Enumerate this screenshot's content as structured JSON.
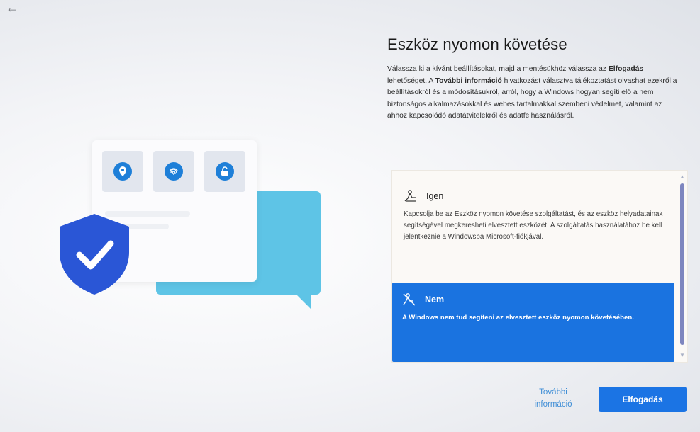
{
  "nav": {
    "back_glyph": "←"
  },
  "page": {
    "title": "Eszköz nyomon követése",
    "description_parts": [
      "Válassza ki a kívánt beállításokat, majd a mentésükhöz válassza az ",
      "Elfogadás",
      " lehetőséget. A ",
      "További információ",
      " hivatkozást választva tájékoztatást olvashat ezekről a beállításokról és a módosításukról, arról, hogy a Windows hogyan segíti elő a nem biztonságos alkalmazásokkal és webes tartalmakkal szembeni védelmet, valamint az ahhoz kapcsolódó adatátvitelekről és adatfelhasználásról."
    ]
  },
  "options": [
    {
      "label": "Igen",
      "icon": "location-person-icon",
      "text": "Kapcsolja be az Eszköz nyomon követése szolgáltatást, és az eszköz helyadatainak segítségével megkeresheti elvesztett eszközét. A szolgáltatás használatához be kell jelentkeznie a Windowsba Microsoft-fiókjával.",
      "selected": false
    },
    {
      "label": "Nem",
      "icon": "location-off-icon",
      "text": "A Windows nem tud segíteni az elvesztett eszköz nyomon követésében.",
      "selected": true
    }
  ],
  "footer": {
    "more_info_line1": "További",
    "more_info_line2": "információ",
    "accept_label": "Elfogadás"
  },
  "colors": {
    "accent": "#1a73e0",
    "shield": "#2a56d6",
    "bubble": "#5ec4e6"
  }
}
